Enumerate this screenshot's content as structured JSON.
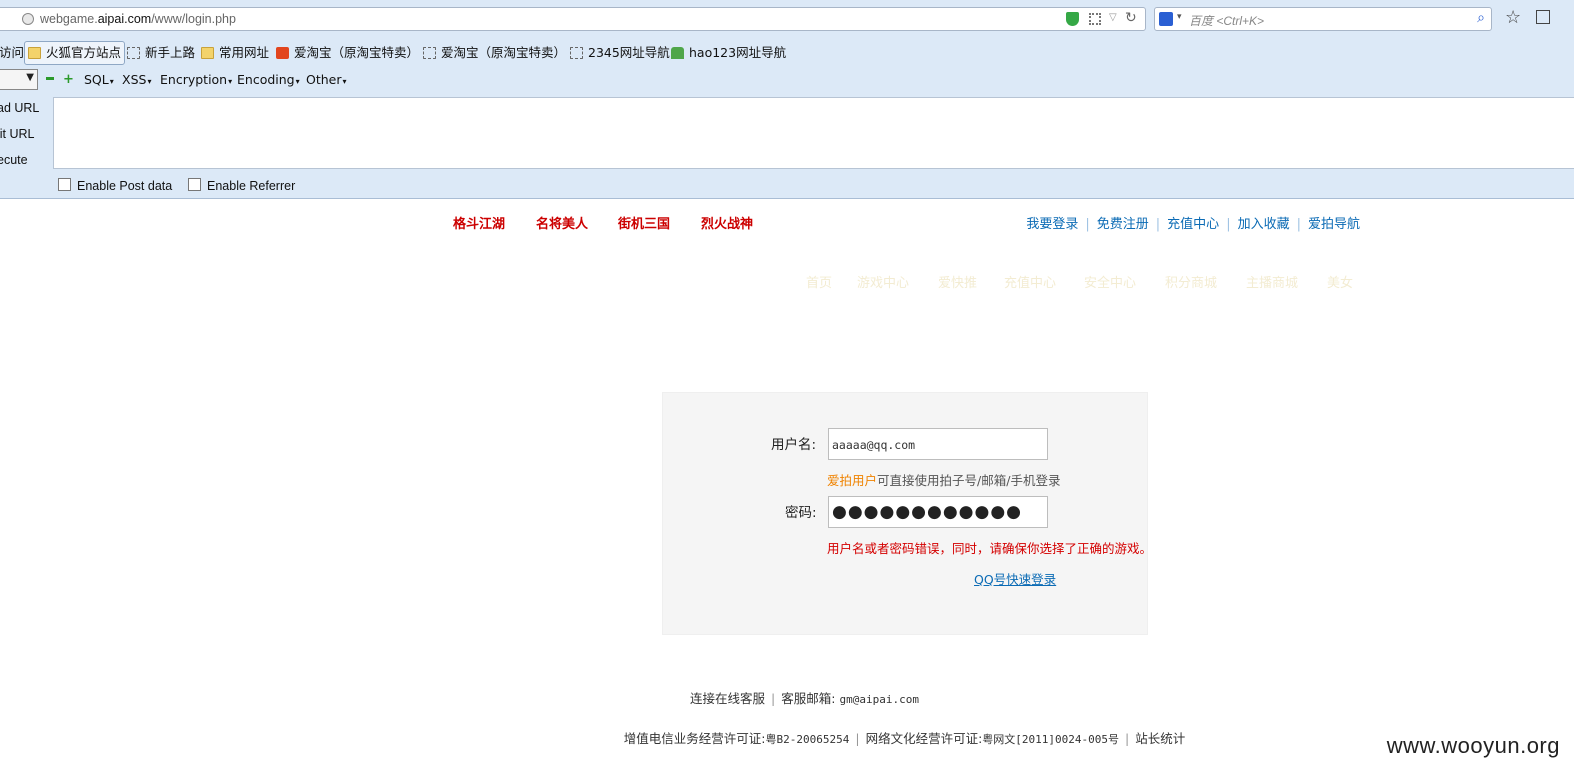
{
  "browser": {
    "url_prefix": "webgame.",
    "url_domain": "aipai.com",
    "url_path": "/www/login.php",
    "search_placeholder": "百度 <Ctrl+K>"
  },
  "bookmarks": [
    {
      "label": "访问",
      "icon": "none"
    },
    {
      "label": "火狐官方站点",
      "icon": "folder-icon"
    },
    {
      "label": "新手上路",
      "icon": "blank-page-icon"
    },
    {
      "label": "常用网址",
      "icon": "folder-icon"
    },
    {
      "label": "爱淘宝（原淘宝特卖）",
      "icon": "taobao-icon"
    },
    {
      "label": "爱淘宝（原淘宝特卖）",
      "icon": "blank-page-icon"
    },
    {
      "label": "2345网址导航",
      "icon": "blank-page-icon"
    },
    {
      "label": "hao123网址导航",
      "icon": "hao123-icon"
    }
  ],
  "hackbar": {
    "menus": [
      "SQL",
      "XSS",
      "Encryption",
      "Encoding",
      "Other"
    ],
    "side": [
      "ad URL",
      "lit URL",
      "ecute"
    ],
    "enable_post": "Enable Post data",
    "enable_referrer": "Enable Referrer"
  },
  "page": {
    "games": [
      "格斗江湖",
      "名将美人",
      "街机三国",
      "烈火战神"
    ],
    "top_links": [
      "我要登录",
      "免费注册",
      "充值中心",
      "加入收藏",
      "爱拍导航"
    ],
    "nav_faint": [
      "首页",
      "游戏中心",
      "爱快推",
      "充值中心",
      "安全中心",
      "积分商城",
      "主播商城",
      "美女"
    ],
    "login": {
      "username_label": "用户名:",
      "username_value": "aaaaa@qq.com",
      "hint_highlight": "爱拍用户",
      "hint_rest": "可直接使用拍子号/邮箱/手机登录",
      "password_label": "密码:",
      "password_mask": "●●●●●●●●●●●●",
      "error": "用户名或者密码错误，同时，请确保你选择了正确的游戏。",
      "qq_login": "QQ号快速登录"
    },
    "footer": {
      "service": "连接在线客服",
      "email_label": "客服邮箱:",
      "email": "gm@aipai.com",
      "icp_label": "增值电信业务经营许可证:",
      "icp": "粤B2-20065254",
      "culture_label": "网络文化经营许可证:",
      "culture": "粤网文[2011]0024-005号",
      "stats": "站长统计"
    }
  },
  "watermark": "www.wooyun.org"
}
